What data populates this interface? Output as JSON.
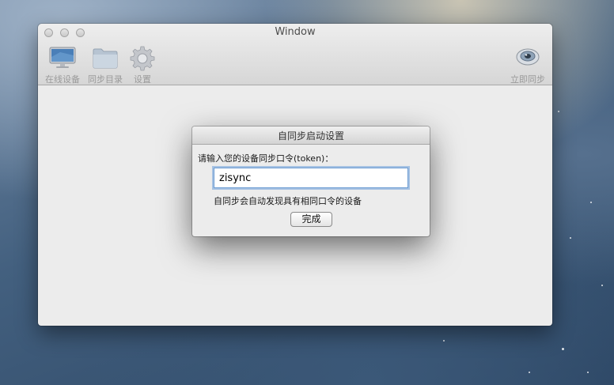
{
  "window": {
    "title": "Window"
  },
  "toolbar": {
    "items": [
      {
        "label": "在线设备",
        "icon": "monitor-icon"
      },
      {
        "label": "同步目录",
        "icon": "folder-icon"
      },
      {
        "label": "设置",
        "icon": "gear-icon"
      }
    ],
    "right_item": {
      "label": "立即同步",
      "icon": "eye-icon"
    }
  },
  "dialog": {
    "title": "自同步启动设置",
    "prompt": "请输入您的设备同步口令(token)：",
    "token_value": "zisync",
    "hint": "自同步会自动发现具有相同口令的设备",
    "done_label": "完成"
  }
}
